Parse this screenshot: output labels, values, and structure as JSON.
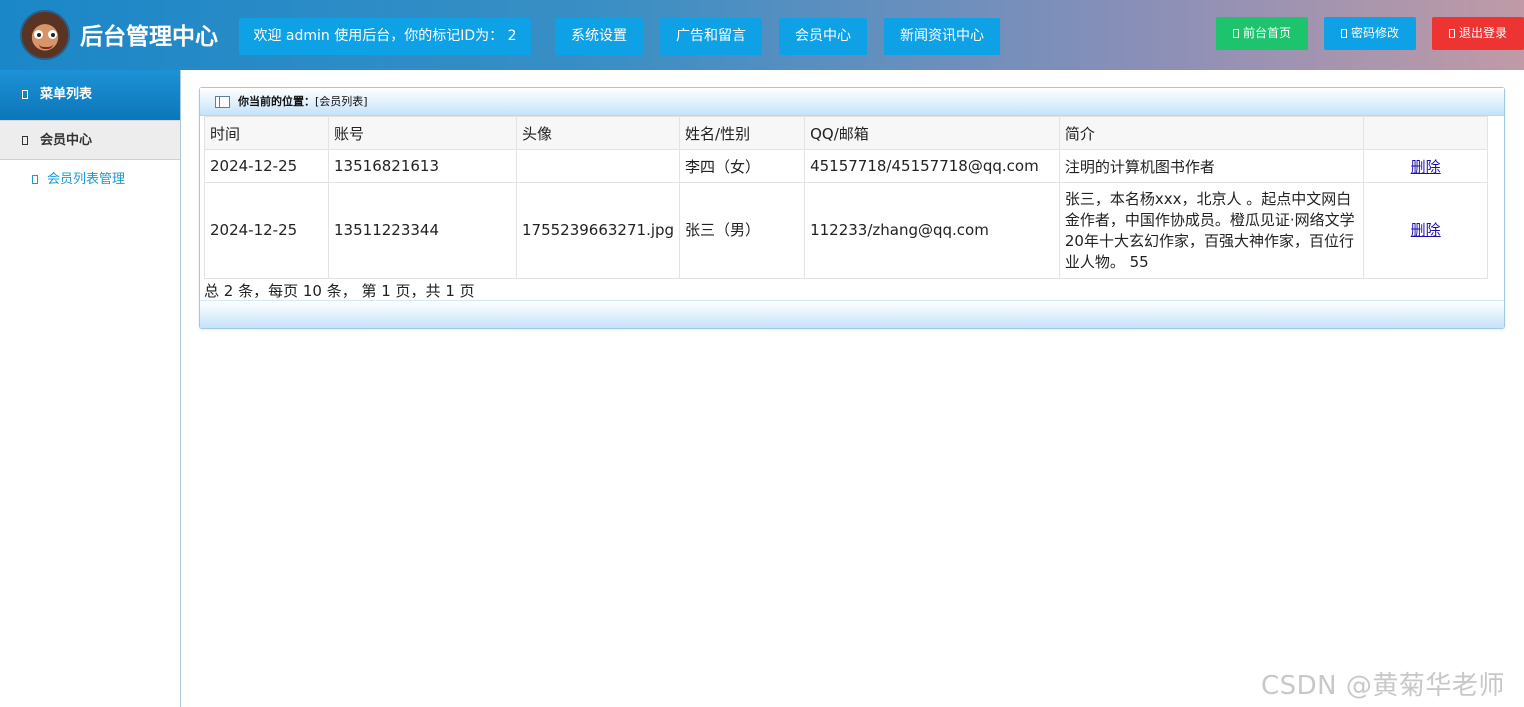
{
  "header": {
    "title": "后台管理中心",
    "welcome": "欢迎 admin 使用后台，你的标记ID为：  2",
    "nav": [
      "系统设置",
      "广告和留言",
      "会员中心",
      "新闻资讯中心"
    ],
    "actions": [
      {
        "label": "前台首页",
        "color": "#1ec36e"
      },
      {
        "label": "密码修改",
        "color": "#0ea1e6"
      },
      {
        "label": "退出登录",
        "color": "#ee3333"
      }
    ]
  },
  "sidebar": {
    "menu_title": "菜单列表",
    "group": "会员中心",
    "items": [
      "会员列表管理"
    ]
  },
  "main": {
    "location_label": "你当前的位置：",
    "location_value": "[会员列表]",
    "columns": [
      "时间",
      "账号",
      "头像",
      "姓名/性别",
      "QQ/邮箱",
      "简介",
      ""
    ],
    "rows": [
      {
        "time": "2024-12-25",
        "account": "13516821613",
        "avatar": "",
        "name": "李四（女）",
        "contact": "45157718/45157718@qq.com",
        "intro": "注明的计算机图书作者",
        "action": "删除"
      },
      {
        "time": "2024-12-25",
        "account": "13511223344",
        "avatar": "1755239663271.jpg",
        "name": "张三（男）",
        "contact": "112233/zhang@qq.com",
        "intro": "张三，本名杨xxx，北京人 。起点中文网白金作者，中国作协成员。橙瓜见证·网络文学20年十大玄幻作家，百强大神作家，百位行业人物。 55",
        "action": "删除"
      }
    ],
    "pagination": "总 2 条，每页 10 条， 第 1 页，共 1 页"
  },
  "watermark": "CSDN @黄菊华老师"
}
